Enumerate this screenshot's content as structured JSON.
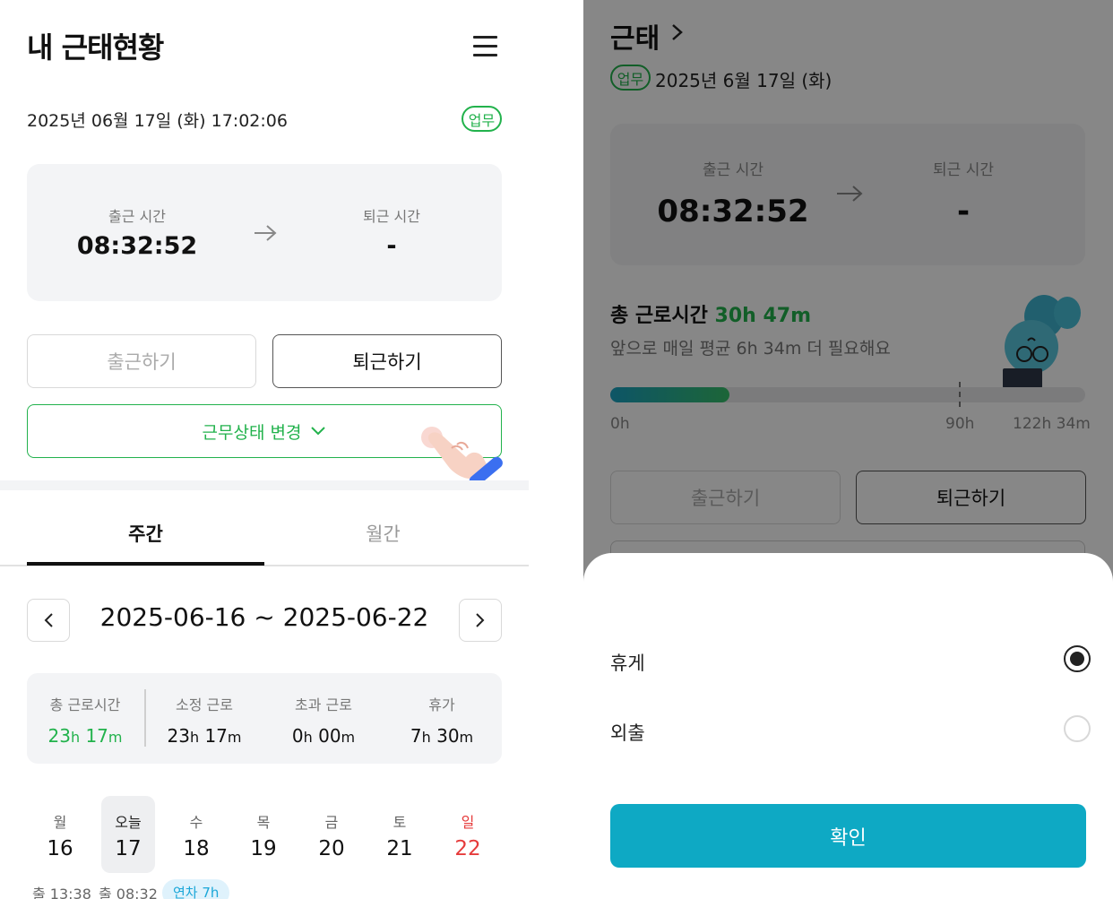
{
  "left": {
    "title": "내 근태현황",
    "datetime": "2025년 06월 17일 (화) 17:02:06",
    "work_badge": "업무",
    "time_card": {
      "clock_in_label": "출근 시간",
      "clock_in_value": "08:32:52",
      "clock_out_label": "퇴근 시간",
      "clock_out_value": "-"
    },
    "clock_in_button": "출근하기",
    "clock_out_button": "퇴근하기",
    "status_change_button": "근무상태 변경",
    "tabs": {
      "weekly": "주간",
      "monthly": "월간",
      "active": "weekly"
    },
    "week_range": "2025-06-16 ~ 2025-06-22",
    "stats": [
      {
        "label": "총 근로시간",
        "h": "23",
        "m": "17",
        "color": "#22b24c"
      },
      {
        "label": "소정 근로",
        "h": "23",
        "m": "17",
        "color": "#111111"
      },
      {
        "label": "초과 근로",
        "h": "0",
        "m": "00",
        "color": "#111111"
      },
      {
        "label": "휴가",
        "h": "7",
        "m": "30",
        "color": "#111111"
      }
    ],
    "stat_units": {
      "h": "h",
      "m": "m"
    },
    "days": [
      {
        "label": "월",
        "num": "16"
      },
      {
        "label": "오늘",
        "num": "17",
        "today": true
      },
      {
        "label": "수",
        "num": "18"
      },
      {
        "label": "목",
        "num": "19"
      },
      {
        "label": "금",
        "num": "20"
      },
      {
        "label": "토",
        "num": "21"
      },
      {
        "label": "일",
        "num": "22",
        "sunday": true
      }
    ],
    "logs": {
      "mon": "출 13:38",
      "today": "출 08:32",
      "leave_badge": "연차 7h"
    }
  },
  "right": {
    "title": "근태",
    "badge": "업무",
    "date": "2025년 6월 17일 (화)",
    "clock_in_label": "출근 시간",
    "clock_in_value": "08:32:52",
    "clock_out_label": "퇴근 시간",
    "clock_out_value": "-",
    "total_label": "총 근로시간",
    "total_value": "30h 47m",
    "need_text": "앞으로 매일 평균 6h 34m 더 필요해요",
    "progress": {
      "current_hours": 30.78,
      "target_hours": 90,
      "max_hours": 122.57
    },
    "ticks": {
      "start": "0h",
      "target": "90h",
      "max": "122h 34m"
    },
    "clock_in_button": "출근하기",
    "clock_out_button": "퇴근하기",
    "sheet": {
      "options": [
        {
          "label": "휴게",
          "selected": true
        },
        {
          "label": "외출",
          "selected": false
        }
      ],
      "confirm": "확인"
    }
  },
  "colors": {
    "accent_green": "#22b24c",
    "confirm_teal": "#0ea9c4",
    "sunday_red": "#e63b3b"
  }
}
